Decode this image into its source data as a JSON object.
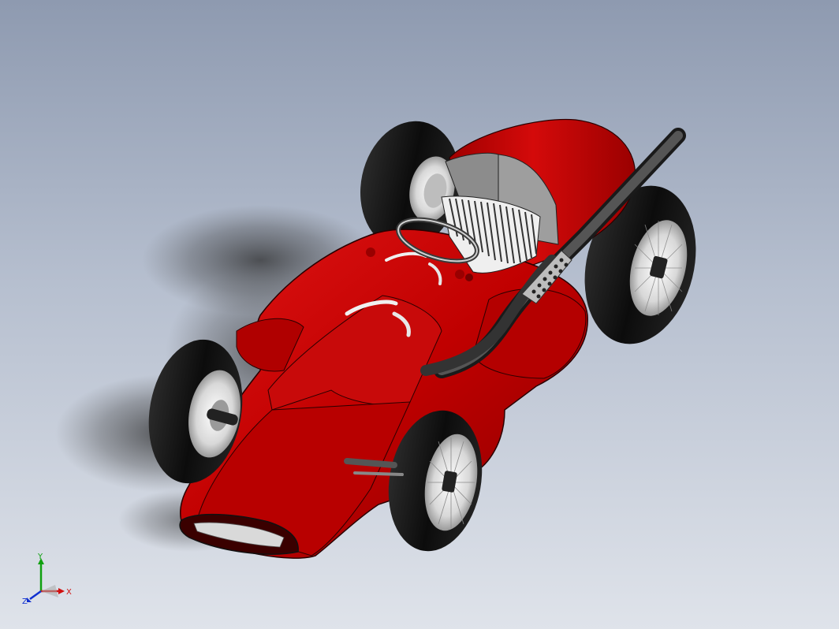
{
  "viewport": {
    "background_top": "#8e9ab0",
    "background_bottom": "#dfe3ea",
    "model": {
      "body_color": "#c00000",
      "tire_color": "#111111",
      "wheel_color": "#d8d8d8",
      "exhaust_color": "#3a3a3a",
      "seat_color": "#f2f2f2"
    }
  },
  "triad": {
    "x_label": "X",
    "y_label": "Y",
    "z_label": "Z",
    "x_color": "#d01010",
    "y_color": "#10a010",
    "z_color": "#1030d0"
  }
}
